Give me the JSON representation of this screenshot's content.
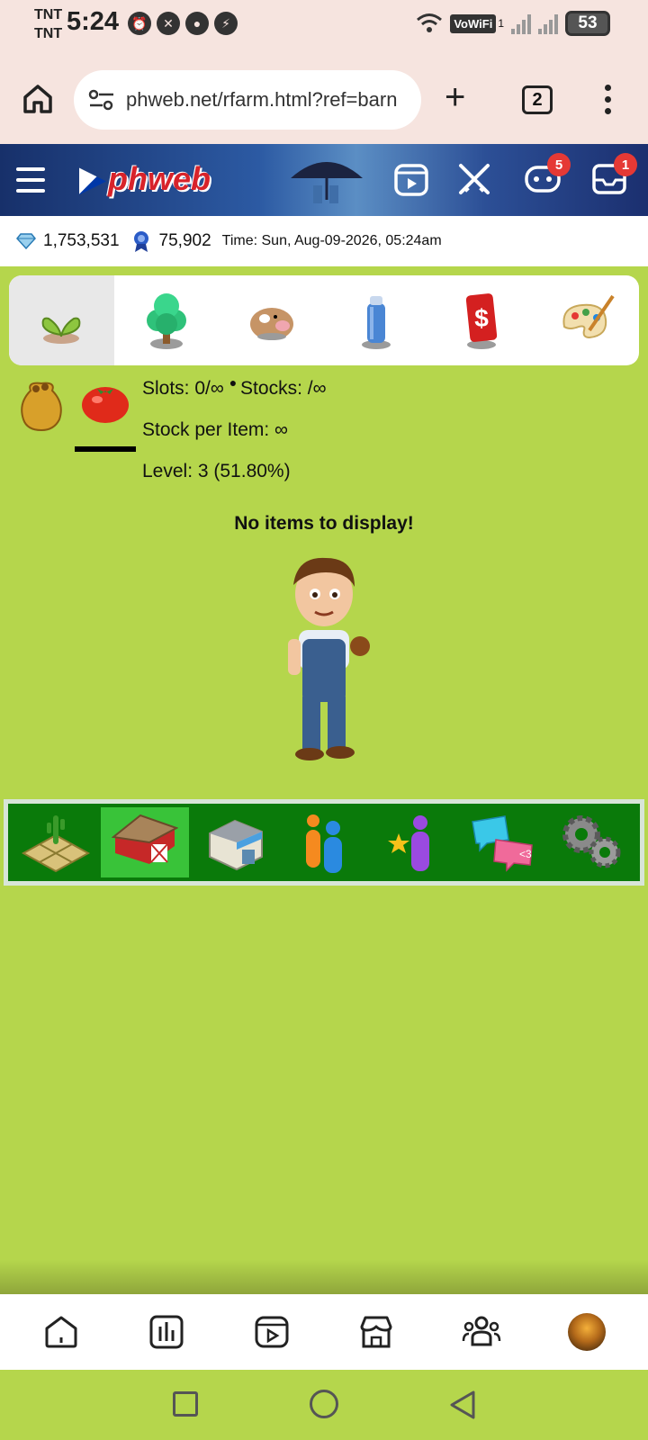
{
  "status_bar": {
    "carrier_1": "TNT",
    "carrier_2": "TNT",
    "time": "5:24",
    "vowifi": "VoWiFi",
    "vowifi_sub": "1",
    "battery": "53"
  },
  "browser": {
    "url": "phweb.net/rfarm.html?ref=barn",
    "tab_count": "2"
  },
  "site_header": {
    "logo": "phweb",
    "chat_badge": "5",
    "inbox_badge": "1"
  },
  "info_bar": {
    "gems": "1,753,531",
    "medals": "75,902",
    "time": "Time: Sun, Aug-09-2026, 05:24am"
  },
  "categories": [
    {
      "name": "seeds",
      "active": true
    },
    {
      "name": "trees",
      "active": false
    },
    {
      "name": "animals",
      "active": false
    },
    {
      "name": "tools",
      "active": false
    },
    {
      "name": "price-tag",
      "active": false
    },
    {
      "name": "decor",
      "active": false
    }
  ],
  "content": {
    "slots": "Slots: 0/∞",
    "stocks": "Stocks: /∞",
    "stock_per_item": "Stock per Item: ∞",
    "level": "Level: 3 (51.80%)",
    "empty_message": "No items to display!"
  },
  "game_nav": [
    {
      "name": "farm",
      "active": false
    },
    {
      "name": "barn",
      "active": true
    },
    {
      "name": "market",
      "active": false
    },
    {
      "name": "neighbors",
      "active": false
    },
    {
      "name": "achievements",
      "active": false
    },
    {
      "name": "chat",
      "active": false
    },
    {
      "name": "settings",
      "active": false
    }
  ],
  "colors": {
    "grass": "#b5d64c",
    "header_blue": "#1b3a7a",
    "nav_green": "#0a7a0a",
    "nav_active": "#39c339",
    "badge_red": "#e53935"
  }
}
